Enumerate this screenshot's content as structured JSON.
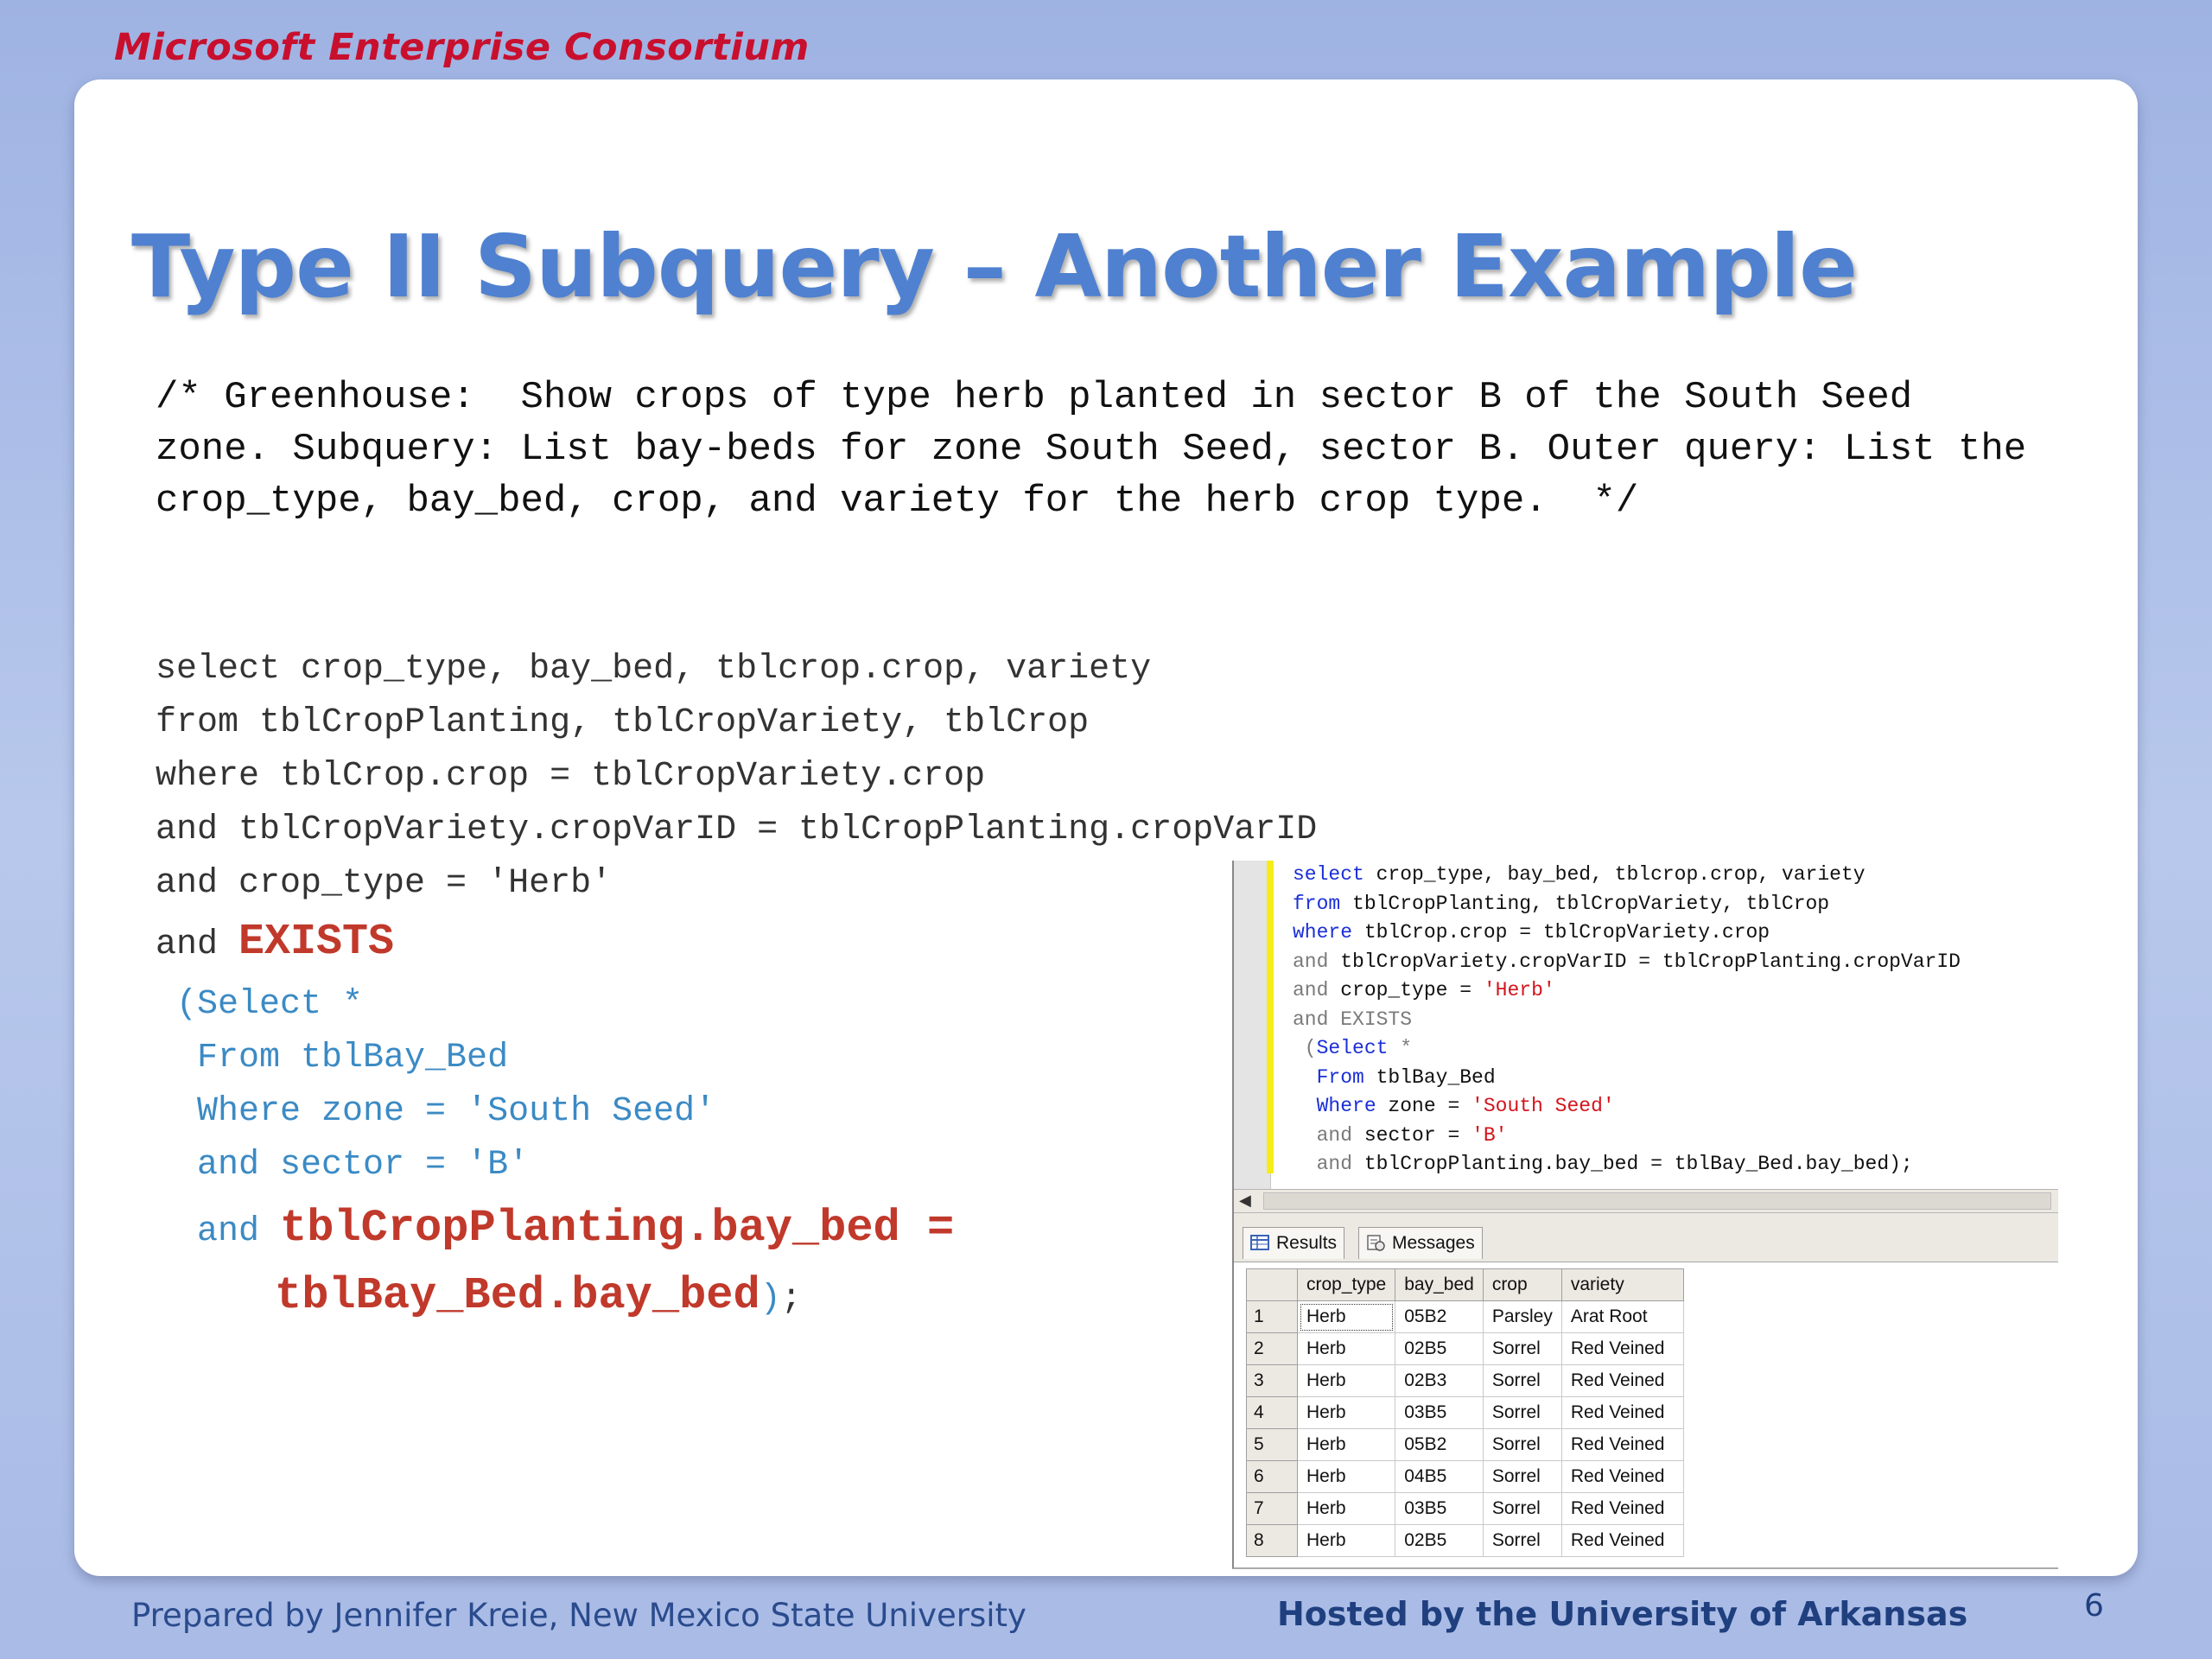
{
  "header": {
    "brand": "Microsoft Enterprise Consortium"
  },
  "slide": {
    "title": "Type II Subquery – Another Example",
    "comment": "/* Greenhouse:  Show crops of type herb planted in sector B of the South Seed zone. Subquery: List bay-beds for zone South Seed, sector B. Outer query: List the crop_type, bay_bed, crop, and variety for the herb crop type.  */",
    "code": {
      "l1": "select crop_type, bay_bed, tblcrop.crop, variety",
      "l2": "from tblCropPlanting, tblCropVariety, tblCrop",
      "l3": "where tblCrop.crop = tblCropVariety.crop",
      "l4": "and tblCropVariety.cropVarID = tblCropPlanting.cropVarID",
      "l5": "and crop_type = 'Herb'",
      "l6_and": "and ",
      "l6_exists": "EXISTS",
      "l7": " (Select *",
      "l8": "  From tblBay_Bed",
      "l9": "  Where zone = 'South Seed'",
      "l10": "  and sector = 'B'",
      "l11_and": "  and ",
      "l11_expr": "tblCropPlanting.bay_bed =",
      "l12_expr": "tblBay_Bed.bay_bed",
      "l12_paren": ")",
      "l12_semi": ";"
    }
  },
  "editor": {
    "kw_select": "select",
    "l1_rest": " crop_type, bay_bed, tblcrop.crop, variety",
    "kw_from": "from",
    "l2_rest": " tblCropPlanting, tblCropVariety, tblCrop",
    "kw_where": "where",
    "l3_rest": " tblCrop.crop = tblCropVariety.crop",
    "kw_and": "and",
    "l4_rest": " tblCropVariety.cropVarID = tblCropPlanting.cropVarID",
    "l5_mid": " crop_type = ",
    "l5_str": "'Herb'",
    "l6": "and EXISTS",
    "l7_paren": " (",
    "kw_select2": "Select",
    "l7_star": " *",
    "kw_from2": "From",
    "l8_rest": " tblBay_Bed",
    "kw_where2": "Where",
    "l9_mid": " zone = ",
    "l9_str": "'South Seed'",
    "l10_mid": " sector = ",
    "l10_str": "'B'",
    "l11_rest": " tblCropPlanting.bay_bed = tblBay_Bed.bay_bed);"
  },
  "results": {
    "tabs": [
      "Results",
      "Messages"
    ],
    "columns": [
      "crop_type",
      "bay_bed",
      "crop",
      "variety"
    ],
    "rows": [
      [
        "1",
        "Herb",
        "05B2",
        "Parsley",
        "Arat Root"
      ],
      [
        "2",
        "Herb",
        "02B5",
        "Sorrel",
        "Red Veined"
      ],
      [
        "3",
        "Herb",
        "02B3",
        "Sorrel",
        "Red Veined"
      ],
      [
        "4",
        "Herb",
        "03B5",
        "Sorrel",
        "Red Veined"
      ],
      [
        "5",
        "Herb",
        "05B2",
        "Sorrel",
        "Red Veined"
      ],
      [
        "6",
        "Herb",
        "04B5",
        "Sorrel",
        "Red Veined"
      ],
      [
        "7",
        "Herb",
        "03B5",
        "Sorrel",
        "Red Veined"
      ],
      [
        "8",
        "Herb",
        "02B5",
        "Sorrel",
        "Red Veined"
      ]
    ]
  },
  "footer": {
    "left": "Prepared by Jennifer Kreie, New Mexico State University",
    "right": "Hosted by the University of Arkansas",
    "page": "6"
  }
}
